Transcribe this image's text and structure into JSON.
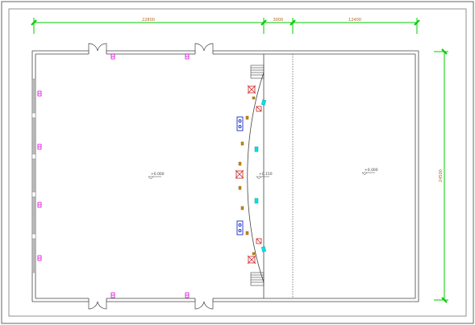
{
  "drawing": {
    "dimensions": {
      "top": [
        "22800",
        "3000",
        "12400"
      ],
      "right": "24500"
    },
    "levels": [
      "+0.000",
      "+0.150",
      "+0.000"
    ]
  },
  "colors": {
    "frame": "#555555",
    "wall": "#444444",
    "dimension": "#00cc00",
    "dimension_text": "#b5651d",
    "magenta_symbol": "#dd00dd",
    "red_furniture": "#cc2222",
    "cyan_furniture": "#00cccc",
    "blue_furniture": "#1a2ecc",
    "orange_furniture": "#cc8800"
  }
}
